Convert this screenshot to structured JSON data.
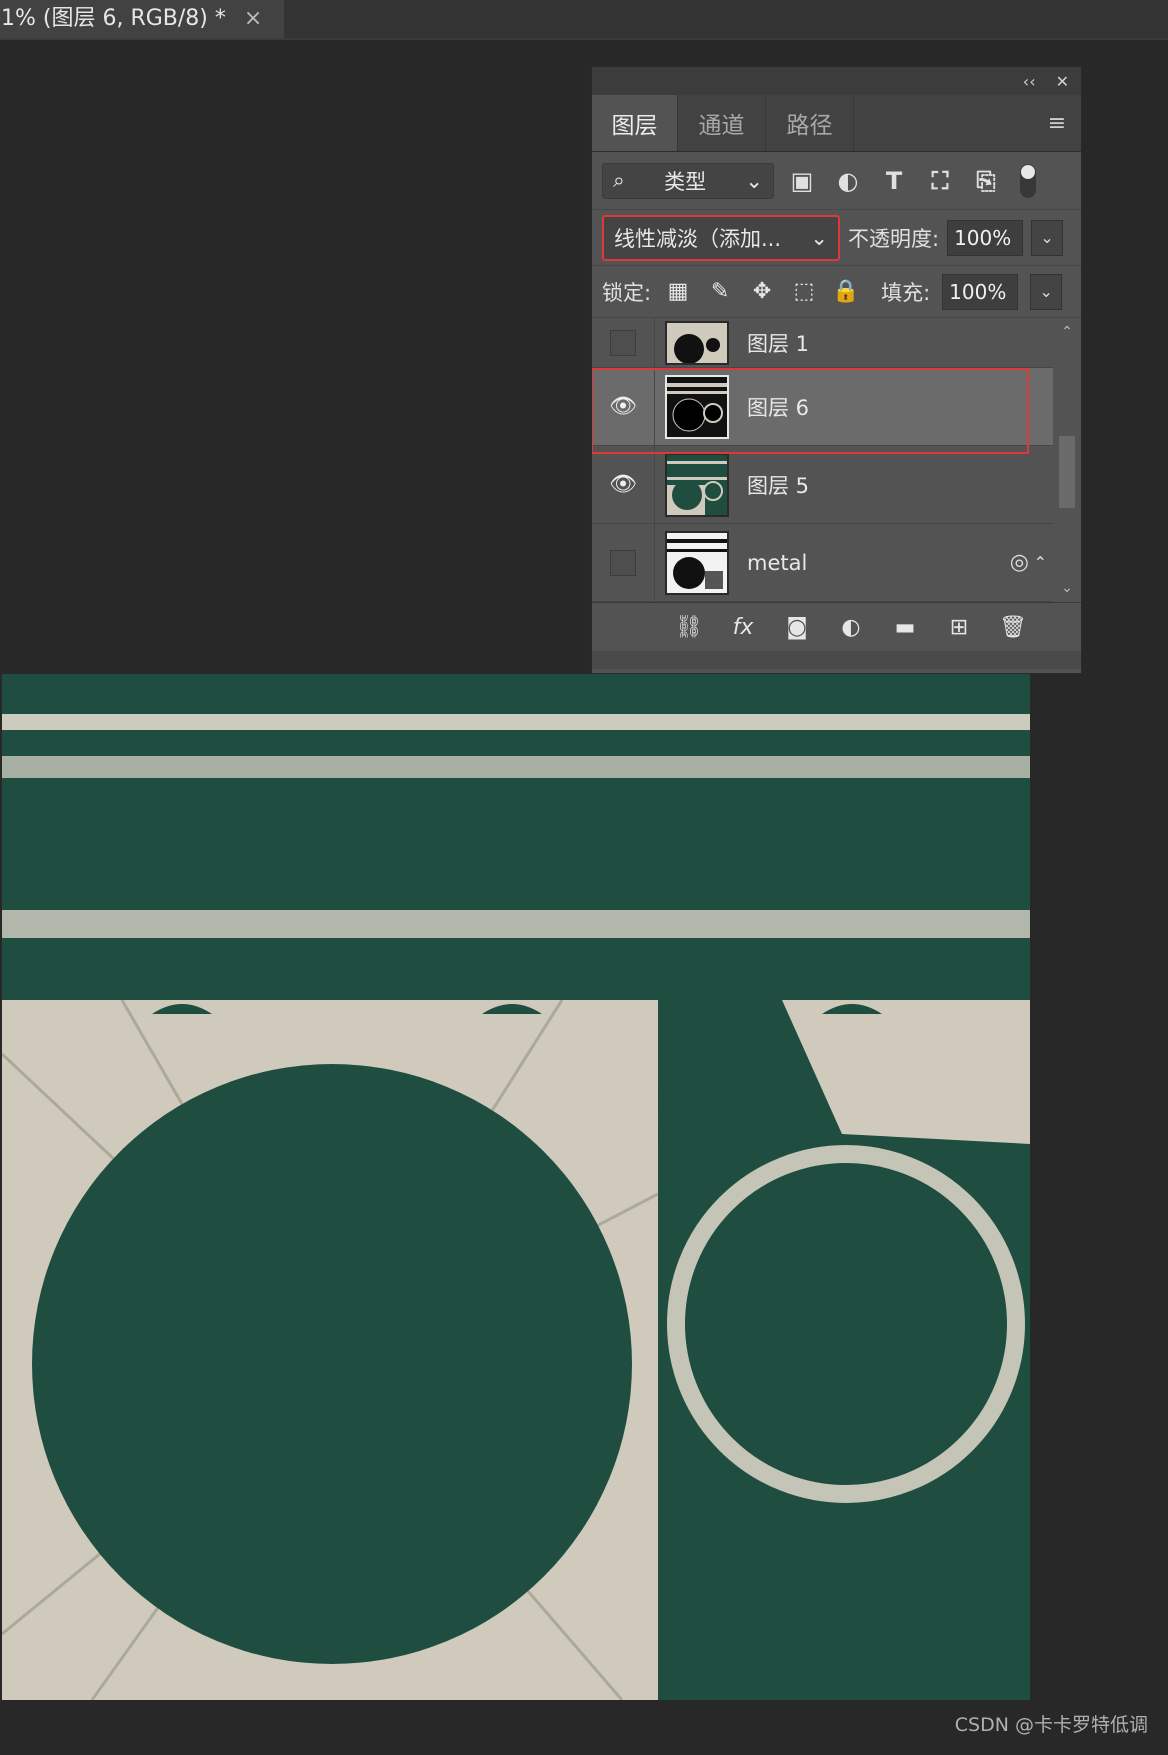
{
  "document_tab": {
    "title": ".1% (图层 6, RGB/8) *",
    "close": "×"
  },
  "panel": {
    "collapse_label": "‹‹",
    "close_label": "✕",
    "tabs": [
      {
        "label": "图层",
        "active": true
      },
      {
        "label": "通道",
        "active": false
      },
      {
        "label": "路径",
        "active": false
      }
    ],
    "filter": {
      "label": "类型",
      "icons": [
        "image-filter-icon",
        "adjustment-filter-icon",
        "type-filter-icon",
        "shape-filter-icon",
        "smart-object-filter-icon"
      ]
    },
    "blend_mode": "线性减淡（添加...",
    "opacity_label": "不透明度:",
    "opacity_value": "100%",
    "lock_label": "锁定:",
    "fill_label": "填充:",
    "fill_value": "100%",
    "layers": [
      {
        "name": "图层 1",
        "visible": false,
        "selected": false
      },
      {
        "name": "图层 6",
        "visible": true,
        "selected": true
      },
      {
        "name": "图层 5",
        "visible": true,
        "selected": false
      },
      {
        "name": "metal",
        "visible": false,
        "selected": false
      }
    ]
  },
  "colors": {
    "canvas_green": "#1f4d40",
    "canvas_cream": "#d6d2c4",
    "highlight_red": "#e03838",
    "panel_bg": "#535353"
  },
  "watermark": "CSDN @卡卡罗特低调"
}
